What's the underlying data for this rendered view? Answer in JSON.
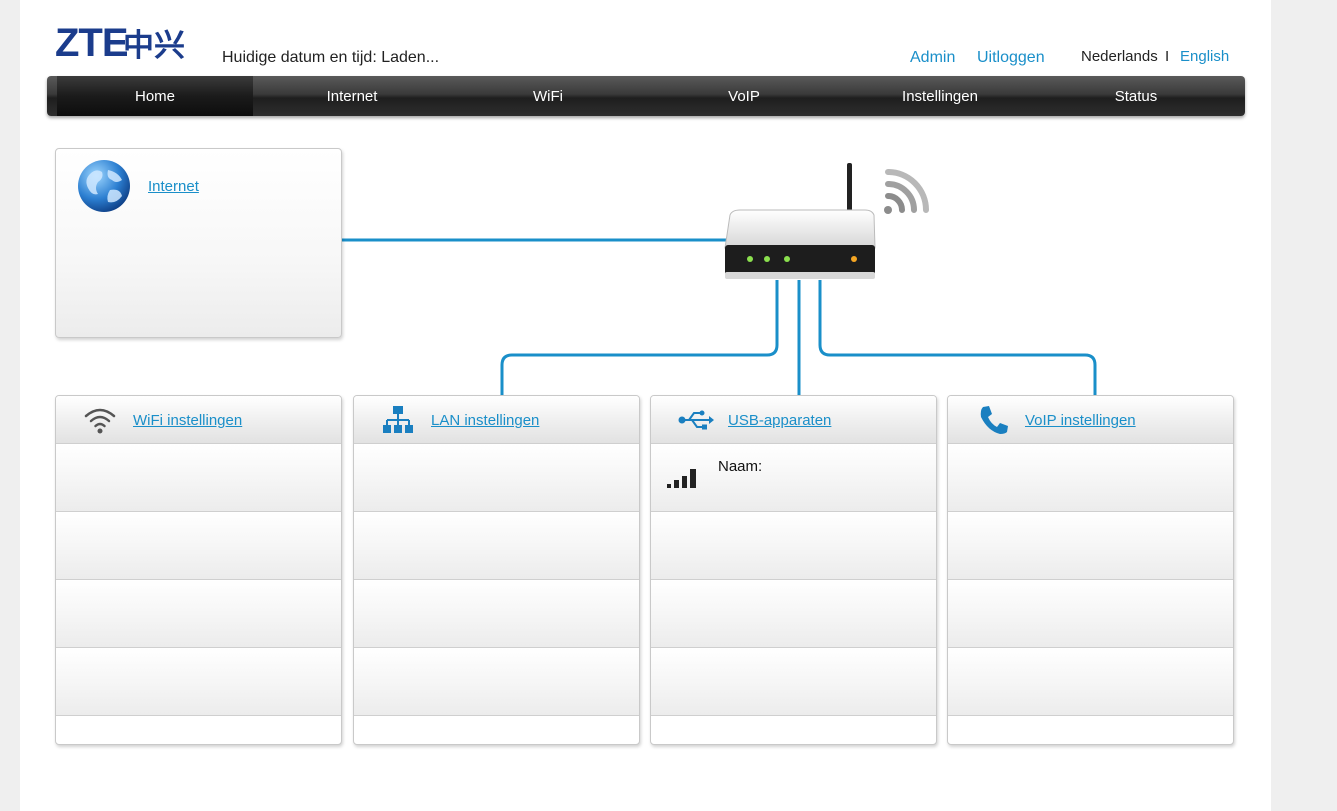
{
  "header": {
    "brand": "ZTE中兴",
    "datetime_text": "Huidige datum en tijd: Laden...",
    "admin_label": "Admin",
    "logout_label": "Uitloggen",
    "lang_nl": "Nederlands",
    "lang_sep": "I",
    "lang_en": "English"
  },
  "nav": {
    "items": [
      "Home",
      "Internet",
      "WiFi",
      "VoIP",
      "Instellingen",
      "Status"
    ],
    "active": "Home"
  },
  "internet": {
    "label": "Internet"
  },
  "panels": {
    "wifi": {
      "label": "WiFi instellingen"
    },
    "lan": {
      "label": "LAN instellingen"
    },
    "usb": {
      "label": "USB-apparaten",
      "name_label": "Naam:"
    },
    "voip": {
      "label": "VoIP instellingen"
    }
  },
  "colors": {
    "accent": "#1a8fc9",
    "nav_bg": "#2e2e2e",
    "brand": "#1b3c8c"
  }
}
